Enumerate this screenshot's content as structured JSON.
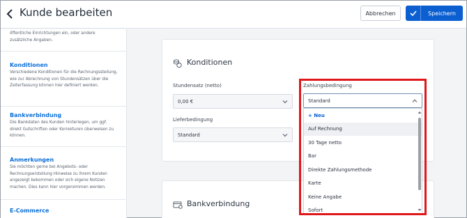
{
  "header": {
    "title": "Kunde bearbeiten",
    "cancel_label": "Abbrechen",
    "save_label": "Speichern"
  },
  "sidebar": {
    "top_desc": "öffentliche Einrichtungen ein, oder andere zusätzliche Angaben.",
    "sections": [
      {
        "title": "Konditionen",
        "desc": "Verschiedene Konditionen für die Rechnungsstellung, wie zur Abrechnung von Stundensätzen über die Zeiterfassung können hier definiert werden."
      },
      {
        "title": "Bankverbindung",
        "desc": "Die Bankdaten des Kunden hinterlegen, um ggf. direkt Gutschriften oder Korrekturen überweisen zu können."
      },
      {
        "title": "Anmerkungen",
        "desc": "Sie möchten gerne bei Angebots- oder Rechnungserstellung Hinweise zu Ihrem Kunden angezeigt bekommen oder sich eigene Notizen machen. Dies kann hier vorgenommen werden."
      },
      {
        "title": "E-Commerce",
        "desc": ""
      }
    ]
  },
  "konditionen": {
    "title": "Konditionen",
    "stundensatz_label": "Stundensatz (netto)",
    "stundensatz_value": "0,00 €",
    "lieferbedingung_label": "Lieferbedingung",
    "lieferbedingung_value": "Standard",
    "zahlungsbedingung_label": "Zahlungsbedingung",
    "zahlungsbedingung_value": "Standard"
  },
  "dropdown": {
    "new_label": "+ Neu",
    "options": [
      "Auf Rechnung",
      "30 Tage netto",
      "Bar",
      "Direkte Zahlungsmethode",
      "Karte",
      "Keine Angabe",
      "Sofort"
    ]
  },
  "bankverbindung": {
    "title": "Bankverbindung"
  },
  "colors": {
    "accent": "#0b5fd1",
    "highlight": "#e0161b"
  }
}
